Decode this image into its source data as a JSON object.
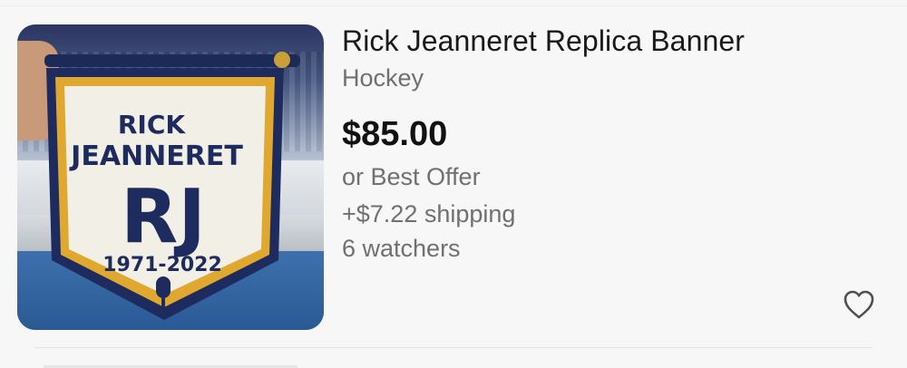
{
  "listing": {
    "title": "Rick Jeanneret Replica Banner",
    "category": "Hockey",
    "price": "$85.00",
    "offer": "or Best Offer",
    "shipping": "+$7.22 shipping",
    "watchers": "6 watchers",
    "favorite_icon": "heart-outline-icon"
  },
  "banner_image": {
    "line1": "RICK",
    "line2": "JEANNERET",
    "monogram": "RJ",
    "years": "1971-2022",
    "emblem_icon": "microphone-icon",
    "colors": {
      "navy": "#1d2b5e",
      "gold": "#e0a82e",
      "cream": "#f2efe6"
    }
  }
}
